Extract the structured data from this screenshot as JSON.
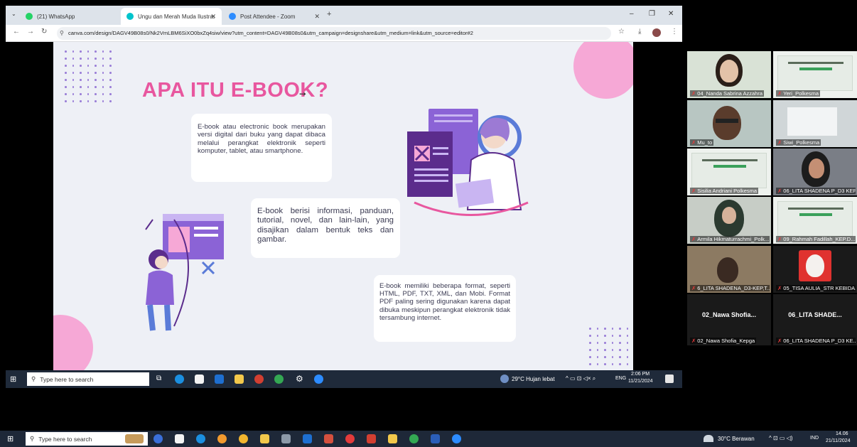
{
  "browser": {
    "tabs": [
      {
        "label": "(21) WhatsApp",
        "active": false,
        "icon": "whatsapp-icon",
        "color": "#25d366"
      },
      {
        "label": "Ungu dan Merah Muda Ilustrasi",
        "active": true,
        "icon": "canva-icon",
        "color": "#00c4cc"
      },
      {
        "label": "Post Attendee - Zoom",
        "active": false,
        "icon": "zoom-icon",
        "color": "#2d8cff"
      }
    ],
    "url": "canva.com/design/DAGV49B08s0/Nk2VmLBM6SiXO0bxZq4siw/view?utm_content=DAGV49B08s0&utm_campaign=designshare&utm_medium=link&utm_source=editor#2"
  },
  "slide": {
    "title": "APA ITU E-BOOK?",
    "card1": "E-book atau electronic book merupakan versi digital dari buku yang dapat dibaca melalui perangkat elektronik seperti komputer, tablet, atau smartphone.",
    "card2": "E-book berisi informasi, panduan, tutorial, novel, dan lain-lain, yang disajikan dalam bentuk teks dan gambar.",
    "card3": "E-book memiliki beberapa format, seperti HTML, PDF, TXT, XML, dan Mobi. Format PDF paling sering digunakan karena dapat dibuka meskipun perangkat elektronik tidak tersambung internet.",
    "colors": {
      "title": "#e8579f",
      "accent_purple": "#6a4bc4",
      "bg": "#eef0f6",
      "pink": "#f6a8d6"
    }
  },
  "inner_taskbar": {
    "search_placeholder": "Type here to search",
    "weather": "29°C  Hujan lebat",
    "lang": "ENG",
    "time": "2:06 PM",
    "date": "11/21/2024"
  },
  "outer_taskbar": {
    "search_placeholder": "Type here to search",
    "weather": "30°C  Berawan",
    "lang": "IND",
    "time": "14.06",
    "date": "21/11/2024"
  },
  "participants": [
    {
      "name": "04_Nanda Sabrina Azzahra",
      "kind": "camera"
    },
    {
      "name": "Yeri_Polkesma",
      "kind": "slide"
    },
    {
      "name": "Mu_to",
      "kind": "camera"
    },
    {
      "name": "Siwi_Polkesma",
      "kind": "slide"
    },
    {
      "name": "Sisilia Andriani Polkesma",
      "kind": "slide"
    },
    {
      "name": "06_LITA SHADENA P_D3 KEPE...",
      "kind": "camera"
    },
    {
      "name": "Armila Hikmaturrachmi_Polk...",
      "kind": "camera"
    },
    {
      "name": "09_Rahmah Fadillah_KEP.D...",
      "kind": "slide"
    },
    {
      "name": "6_LITA SHADENA_D3-KEP,T...",
      "kind": "camera"
    },
    {
      "name": "05_TISA AULIA_STR KEBIDA...",
      "kind": "avatar"
    },
    {
      "name": "02_Nawa Shofia_Kepga",
      "display": "02_Nawa Shofia...",
      "kind": "name"
    },
    {
      "name": "06_LITA SHADENA P_D3 KE...",
      "display": "06_LITA SHADE...",
      "kind": "name"
    }
  ]
}
